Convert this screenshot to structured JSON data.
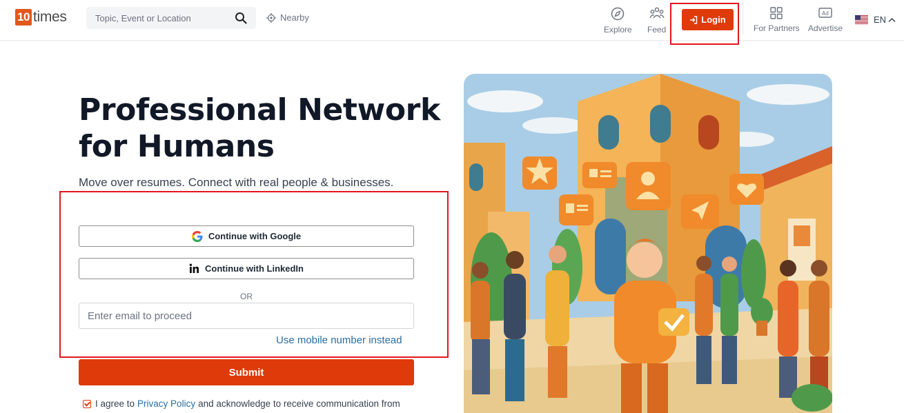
{
  "header": {
    "logo_num": "10",
    "logo_text": "times",
    "search_placeholder": "Topic, Event or Location",
    "nearby": "Nearby",
    "nav": {
      "explore": "Explore",
      "feed": "Feed",
      "login": "Login",
      "partners": "For Partners",
      "advertise": "Advertise"
    },
    "language": "EN"
  },
  "hero": {
    "title_line1": "Professional Network",
    "title_line2": "for Humans",
    "subtitle": "Move over resumes. Connect with real people & businesses."
  },
  "form": {
    "google": "Continue with Google",
    "linkedin": "Continue with LinkedIn",
    "or": "OR",
    "email_placeholder": "Enter email to proceed",
    "mobile_link": "Use mobile number instead",
    "submit": "Submit",
    "agree_prefix": "I agree to",
    "privacy": "Privacy Policy",
    "agree_suffix": "and acknowledge to receive communication from"
  },
  "icons": {
    "search": "search-icon",
    "nearby": "crosshair-icon",
    "explore": "compass-icon",
    "feed": "people-icon",
    "login": "login-arrow-icon",
    "partners": "grid-icon",
    "advertise": "ad-icon",
    "flag": "us-flag-icon",
    "chevron": "chevron-up-icon",
    "google": "google-icon",
    "linkedin": "linkedin-icon"
  },
  "colors": {
    "brand": "#e03a09",
    "highlight": "#e3161d",
    "link": "#2b6da3"
  }
}
